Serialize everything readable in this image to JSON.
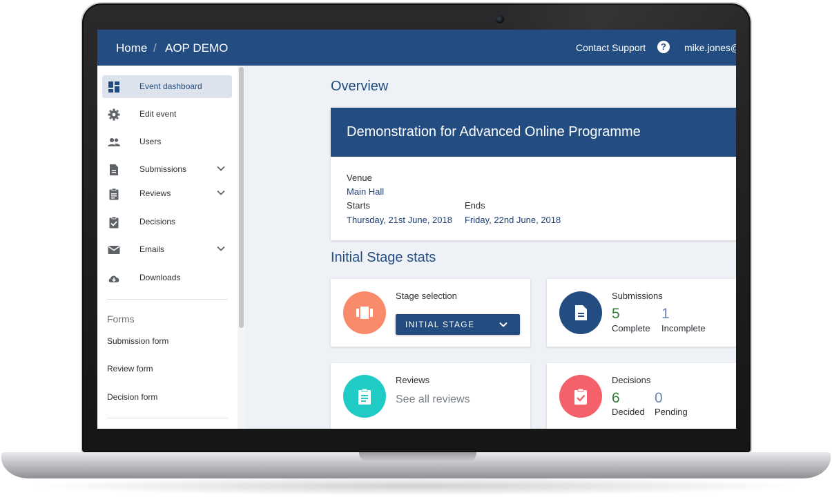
{
  "header": {
    "breadcrumb": [
      "Home",
      "AOP DEMO"
    ],
    "separator": "/",
    "contact_support": "Contact Support",
    "help_icon": "?",
    "user": "mike.jones@"
  },
  "sidebar": {
    "items": [
      {
        "label": "Event dashboard",
        "icon": "dashboard-icon",
        "active": true
      },
      {
        "label": "Edit event",
        "icon": "gear-icon"
      },
      {
        "label": "Users",
        "icon": "people-icon"
      },
      {
        "label": "Submissions",
        "icon": "document-icon",
        "expandable": true
      },
      {
        "label": "Reviews",
        "icon": "clipboard-icon",
        "expandable": true
      },
      {
        "label": "Decisions",
        "icon": "clipboard-check-icon"
      },
      {
        "label": "Emails",
        "icon": "mail-icon",
        "expandable": true
      },
      {
        "label": "Downloads",
        "icon": "cloud-download-icon"
      }
    ],
    "forms_heading": "Forms",
    "forms": [
      "Submission form",
      "Review form",
      "Decision form"
    ]
  },
  "main": {
    "overview_title": "Overview",
    "event": {
      "title": "Demonstration for Advanced Online Programme",
      "venue_label": "Venue",
      "venue": "Main Hall",
      "starts_label": "Starts",
      "starts": "Thursday, 21st June, 2018",
      "ends_label": "Ends",
      "ends": "Friday, 22nd June, 2018"
    },
    "stats_title": "Initial Stage stats",
    "stage_selection": {
      "title": "Stage selection",
      "selected": "INITIAL STAGE"
    },
    "submissions": {
      "title": "Submissions",
      "complete": "5",
      "complete_label": "Complete",
      "incomplete": "1",
      "incomplete_label": "Incomplete"
    },
    "reviews": {
      "title": "Reviews",
      "link": "See all reviews"
    },
    "decisions": {
      "title": "Decisions",
      "decided": "6",
      "decided_label": "Decided",
      "pending": "0",
      "pending_label": "Pending"
    }
  },
  "colors": {
    "brand": "#234d80",
    "stage_circle": "#f98b6b",
    "submissions_circle": "#234d80",
    "reviews_circle": "#1fcbc4",
    "decisions_circle": "#f4616a",
    "positive_number": "#2e7d32",
    "neutral_number": "#6a88ad"
  }
}
